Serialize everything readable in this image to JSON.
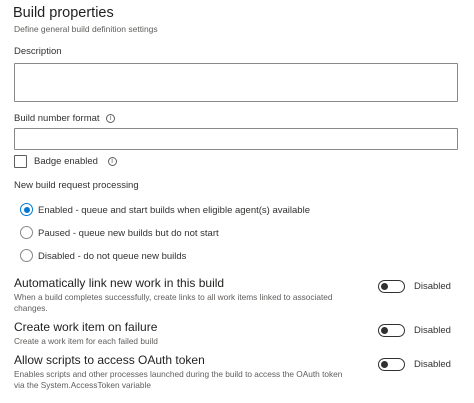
{
  "header": {
    "title": "Build properties",
    "subtitle": "Define general build definition settings"
  },
  "description": {
    "label": "Description",
    "value": ""
  },
  "build_number_format": {
    "label": "Build number format",
    "value": "",
    "icon": "info-icon"
  },
  "badge": {
    "label": "Badge enabled",
    "checked": false,
    "icon": "info-icon"
  },
  "new_build_request": {
    "label": "New build request processing",
    "options": [
      {
        "label": "Enabled - queue and start builds when eligible agent(s) available",
        "selected": true
      },
      {
        "label": "Paused - queue new builds but do not start",
        "selected": false
      },
      {
        "label": "Disabled - do not queue new builds",
        "selected": false
      }
    ]
  },
  "toggles": [
    {
      "title": "Automatically link new work in this build",
      "description": "When a build completes successfully, create links to all work items linked to associated changes.",
      "state": "Disabled",
      "on": false
    },
    {
      "title": "Create work item on failure",
      "description": "Create a work item for each failed build",
      "state": "Disabled",
      "on": false
    },
    {
      "title": "Allow scripts to access OAuth token",
      "description": "Enables scripts and other processes launched during the build to access the OAuth token via the System.AccessToken variable",
      "state": "Disabled",
      "on": false
    }
  ],
  "colors": {
    "accent": "#0078d4",
    "border": "#8a8886",
    "text": "#323130",
    "muted": "#605e5c"
  }
}
